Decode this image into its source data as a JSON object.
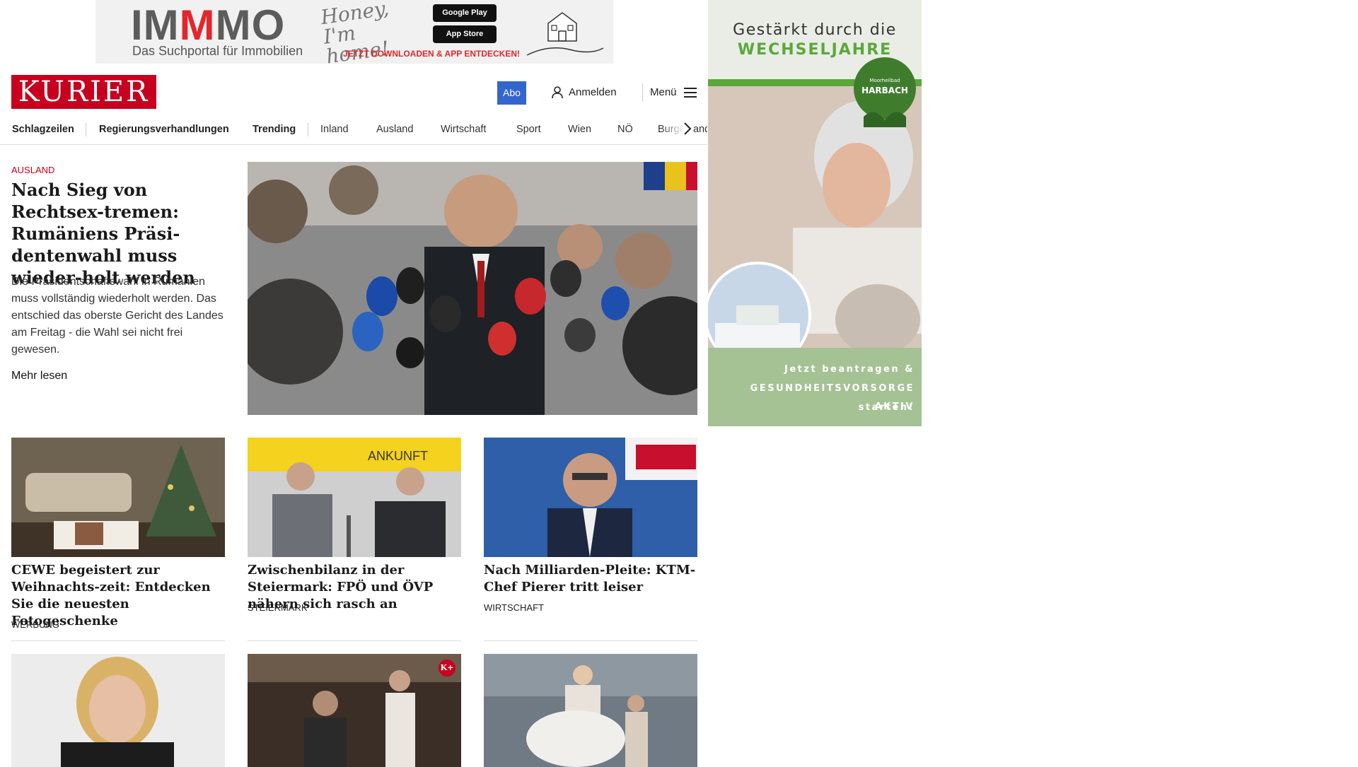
{
  "top_ad": {
    "brand_part1": "IM",
    "brand_part2": "M",
    "brand_part3": "MO",
    "script_text": "Honey, I'm home!",
    "tagline": "Das Suchportal für Immobilien",
    "google_play_label": "Google Play",
    "app_store_label": "App Store",
    "cta": "JETZT DOWNLOADEN & APP ENTDECKEN!"
  },
  "header": {
    "logo_text": "KURIER",
    "abo_label": "Abo",
    "login_label": "Anmelden",
    "menu_label": "Menü",
    "login_icon": "user-icon",
    "menu_icon": "hamburger-icon",
    "brand_color": "#c6001e",
    "accent_color": "#3366cc"
  },
  "nav": {
    "items": [
      "Schlagzeilen",
      "Regierungsverhandlungen",
      "Trending",
      "Inland",
      "Ausland",
      "Wirtschaft",
      "Sport",
      "Wien",
      "NÖ",
      "Burgenland"
    ],
    "arrow_icon": "chevron-right-icon"
  },
  "lead": {
    "section": "AUSLAND",
    "title": "Nach Sieg von Rechtsex-tremen: Rumäniens Präsi-dentenwahl muss wieder-holt werden",
    "teaser": "Die Präsidentschaftswahl in Rumänien muss vollständig wiederholt werden. Das entschied das oberste Gericht des Landes am Freitag - die Wahl sei nicht frei gewesen.",
    "more_label": "Mehr lesen"
  },
  "cards": [
    {
      "title": "CEWE begeistert zur Weihnachts-zeit: Entdecken Sie die neuesten Fotogeschenke",
      "section": "WERBUNG"
    },
    {
      "title": "Zwischenbilanz in der Steiermark: FPÖ und ÖVP nähern sich rasch an",
      "section": "STEIERMARK"
    },
    {
      "title": "Nach Milliarden-Pleite: KTM-Chef Pierer tritt leiser",
      "section": "WIRTSCHAFT"
    }
  ],
  "second_row": {
    "plus_badge": "K+"
  },
  "images": {
    "lead_sign": "",
    "card2_sign": "ANKUNFT"
  },
  "side_ad": {
    "headline1": "Gestärkt durch die",
    "headline2": "WECHSELJAHRE",
    "badge_small": "Moorheilbad",
    "badge_big": "HARBACH",
    "cta1": "Jetzt beantragen &",
    "cta2": "GESUNDHEITSVORSORGE AKTIV",
    "cta3": "starten!"
  }
}
